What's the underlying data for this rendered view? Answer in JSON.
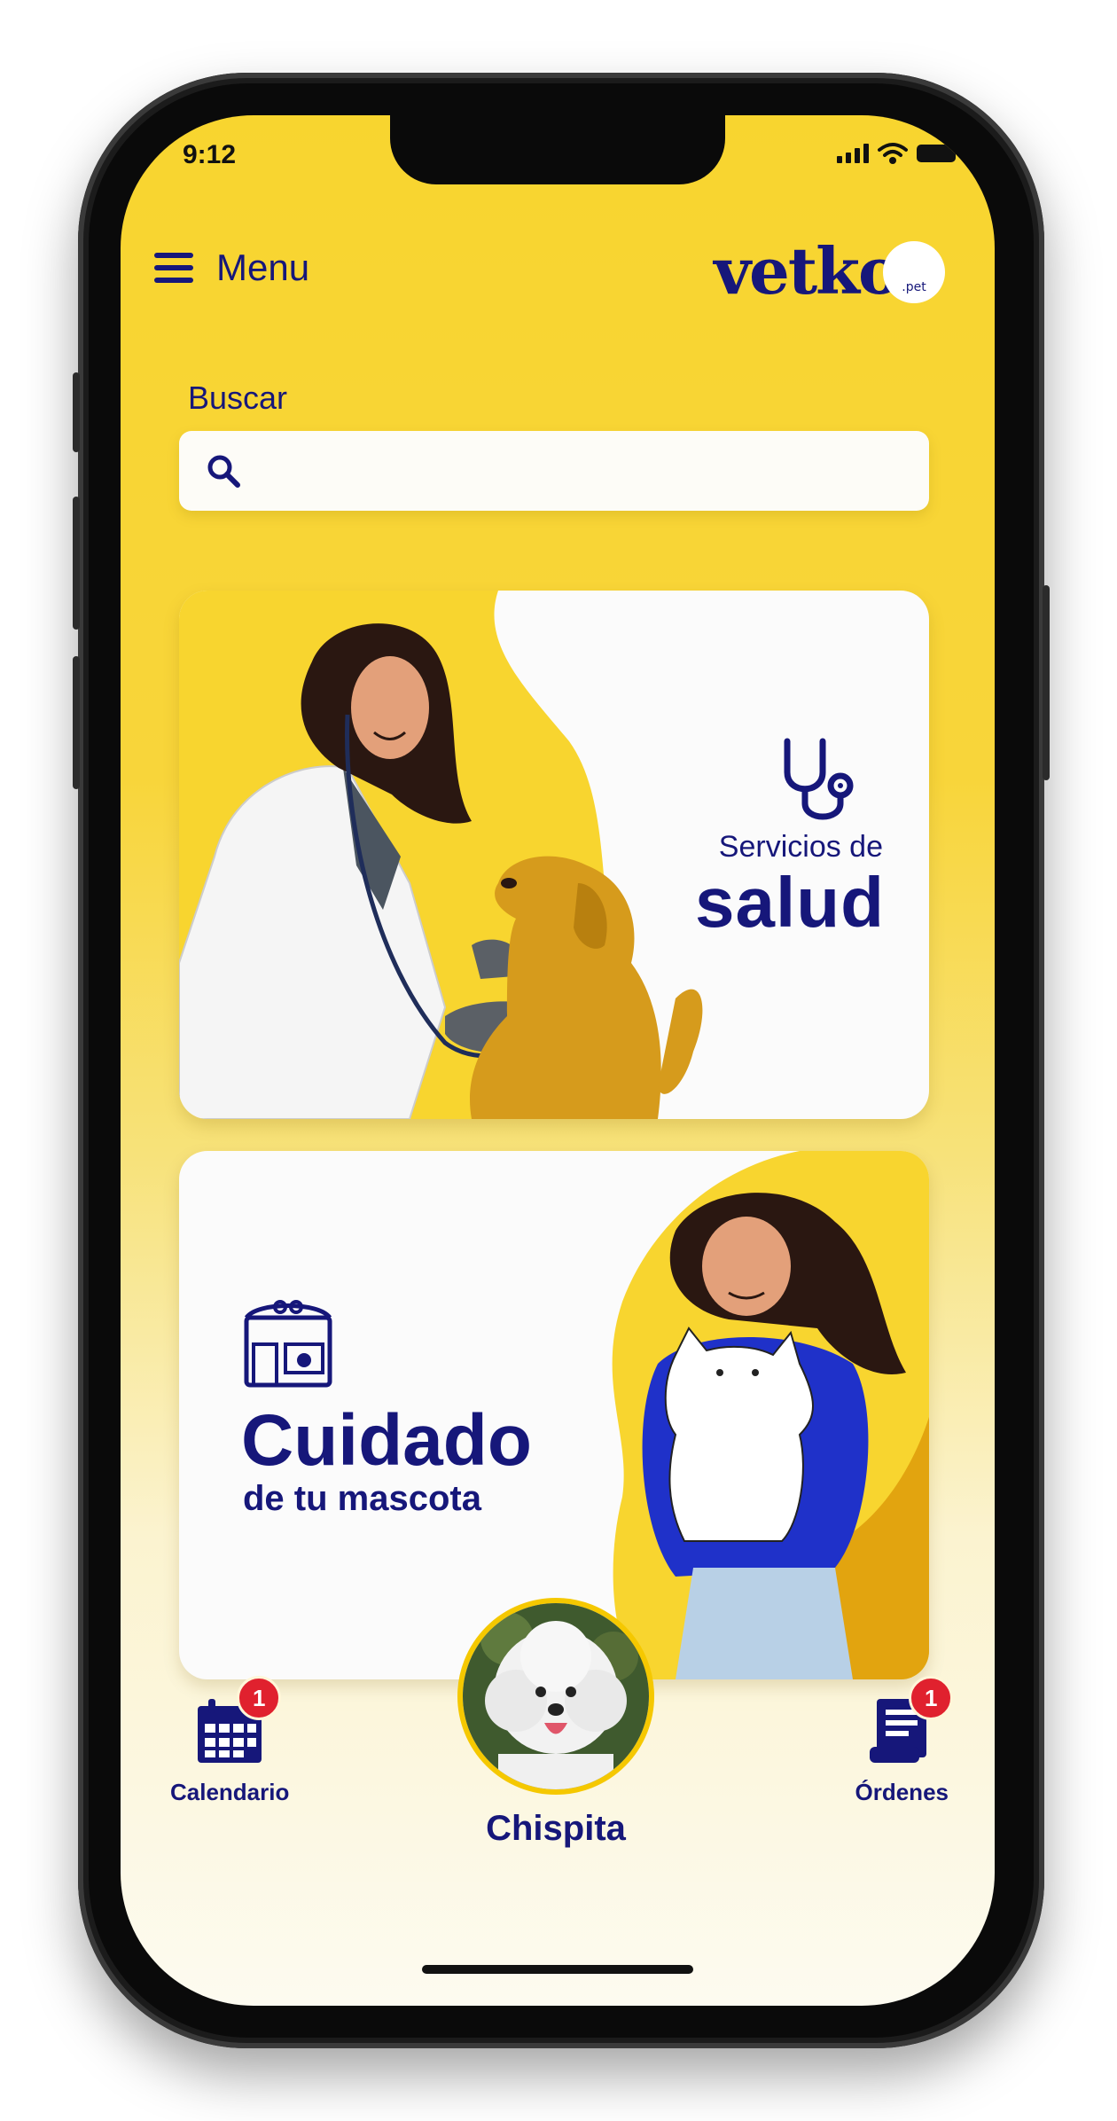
{
  "status_bar": {
    "time": "9:12"
  },
  "header": {
    "menu_label": "Menu",
    "logo_text": "vetko",
    "logo_suffix": ".pet"
  },
  "search": {
    "label": "Buscar",
    "value": "",
    "placeholder": ""
  },
  "cards": [
    {
      "title_small": "Servicios de",
      "title_large": "salud",
      "icon": "stethoscope-icon"
    },
    {
      "title_large": "Cuidado",
      "title_small": "de tu mascota",
      "icon": "pet-shop-icon"
    }
  ],
  "bottom_nav": {
    "calendar": {
      "label": "Calendario",
      "badge": "1",
      "icon": "calendar-icon"
    },
    "pet": {
      "name": "Chispita"
    },
    "orders": {
      "label": "Órdenes",
      "badge": "1",
      "icon": "orders-icon"
    }
  },
  "colors": {
    "brand_navy": "#16177a",
    "brand_yellow": "#f8d52f",
    "badge_red": "#e0212e"
  }
}
